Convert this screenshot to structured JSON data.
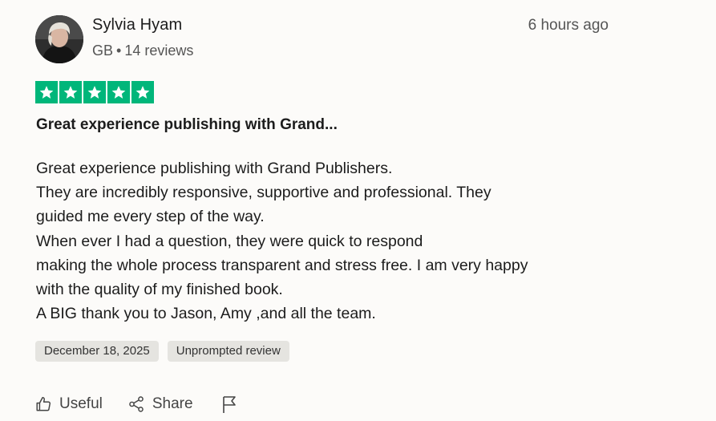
{
  "reviewer": {
    "name": "Sylvia Hyam",
    "country": "GB",
    "separator": "•",
    "review_count": "14 reviews",
    "time_ago": "6 hours ago"
  },
  "rating": {
    "stars": 5,
    "max": 5,
    "color": "#00b67a"
  },
  "review": {
    "title": "Great experience publishing with Grand...",
    "body_lines": [
      "Great experience publishing with Grand Publishers.",
      "They are incredibly responsive, supportive and professional. They",
      "guided me every step of the way.",
      "When ever I had a question, they were quick to respond",
      "making the whole process transparent and stress free. I am very happy",
      "with the quality of my finished book.",
      "A BIG thank you to Jason, Amy ,and all the team."
    ]
  },
  "tags": {
    "date": "December 18, 2025",
    "type": "Unprompted review"
  },
  "actions": {
    "useful_label": "Useful",
    "share_label": "Share",
    "icons": [
      "thumbs-up-icon",
      "share-icon",
      "flag-icon"
    ]
  }
}
